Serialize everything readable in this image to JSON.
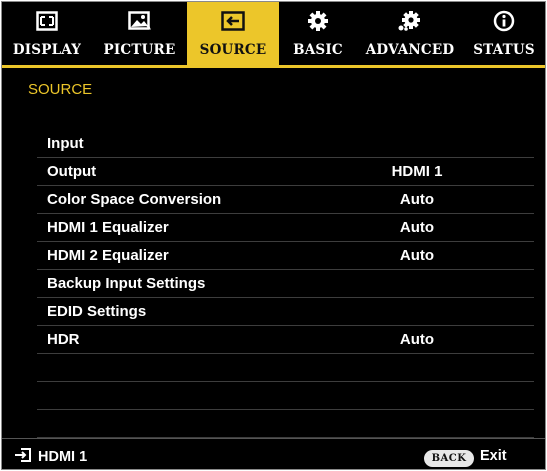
{
  "tabs": [
    {
      "label": "DISPLAY",
      "icon": "display-icon"
    },
    {
      "label": "PICTURE",
      "icon": "picture-icon"
    },
    {
      "label": "SOURCE",
      "icon": "source-icon",
      "active": true
    },
    {
      "label": "BASIC",
      "icon": "gear-icon"
    },
    {
      "label": "ADVANCED",
      "icon": "advanced-gear-icon"
    },
    {
      "label": "STATUS",
      "icon": "info-icon"
    }
  ],
  "section": {
    "title": "SOURCE"
  },
  "menu": {
    "items": [
      {
        "name": "Input",
        "value": ""
      },
      {
        "name": "Output",
        "value": "HDMI 1"
      },
      {
        "name": "Color Space Conversion",
        "value": "Auto"
      },
      {
        "name": "HDMI 1 Equalizer",
        "value": "Auto"
      },
      {
        "name": "HDMI 2 Equalizer",
        "value": "Auto"
      },
      {
        "name": "Backup Input Settings",
        "value": ""
      },
      {
        "name": "EDID Settings",
        "value": ""
      },
      {
        "name": "HDR",
        "value": "Auto"
      }
    ]
  },
  "footer": {
    "current_input": "HDMI 1",
    "back_label": "BACK",
    "exit_label": "Exit"
  },
  "colors": {
    "accent": "#ecc62a",
    "background": "#000000",
    "text": "#ffffff"
  }
}
